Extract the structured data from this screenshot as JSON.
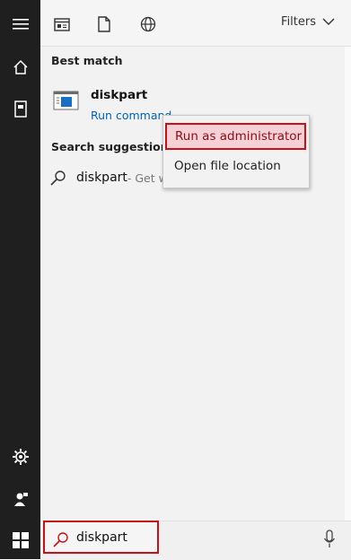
{
  "top_bar": {
    "filters_label": "Filters"
  },
  "best_match": {
    "heading": "Best match",
    "app_name": "diskpart",
    "app_subtitle": "Run command"
  },
  "suggestions": {
    "heading": "Search suggestions",
    "item_query": "diskpart",
    "item_rest": " - Get w"
  },
  "context_menu": {
    "items": [
      "Run as administrator",
      "Open file location"
    ]
  },
  "search": {
    "value": "diskpart"
  },
  "colors": {
    "highlight_border": "#c7101a",
    "link_blue": "#0063b1",
    "rail": "#1f1f1f"
  }
}
